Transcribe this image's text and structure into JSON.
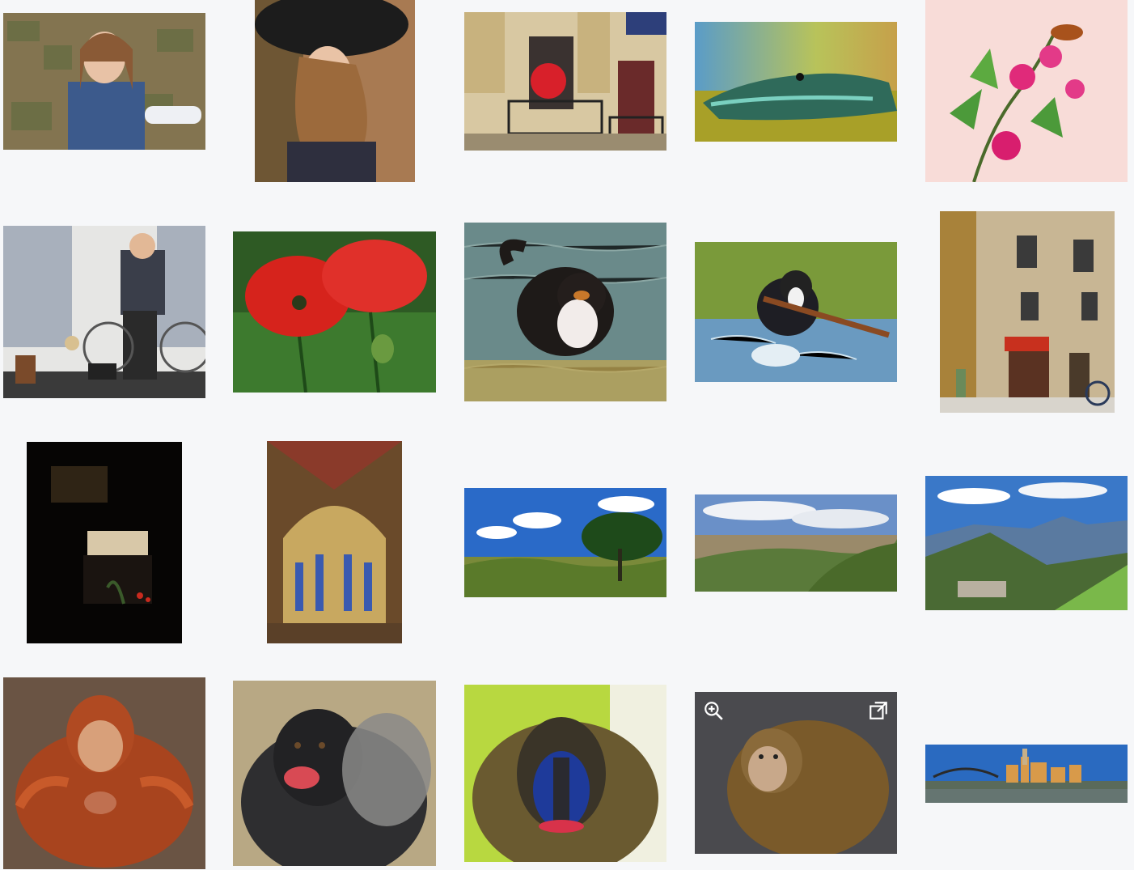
{
  "gallery": {
    "photos": [
      {
        "subject": "girl-stone-wall"
      },
      {
        "subject": "woman-black-hat"
      },
      {
        "subject": "balcony-red-umbrella"
      },
      {
        "subject": "crocodile"
      },
      {
        "subject": "pink-flower-bee"
      },
      {
        "subject": "street-performer-bicycle"
      },
      {
        "subject": "red-poppies"
      },
      {
        "subject": "bernese-dog-water"
      },
      {
        "subject": "border-collie-stick"
      },
      {
        "subject": "old-building-shop"
      },
      {
        "subject": "dark-altar-book"
      },
      {
        "subject": "cathedral-interior"
      },
      {
        "subject": "landscape-tree"
      },
      {
        "subject": "city-valley-view"
      },
      {
        "subject": "mountain-landscape"
      },
      {
        "subject": "orangutan"
      },
      {
        "subject": "gorilla"
      },
      {
        "subject": "mandrill"
      },
      {
        "subject": "macaque"
      },
      {
        "subject": "river-city-panorama"
      }
    ],
    "hover_actions": {
      "zoom_icon": "zoom-in-icon",
      "open_icon": "open-external-icon"
    }
  }
}
